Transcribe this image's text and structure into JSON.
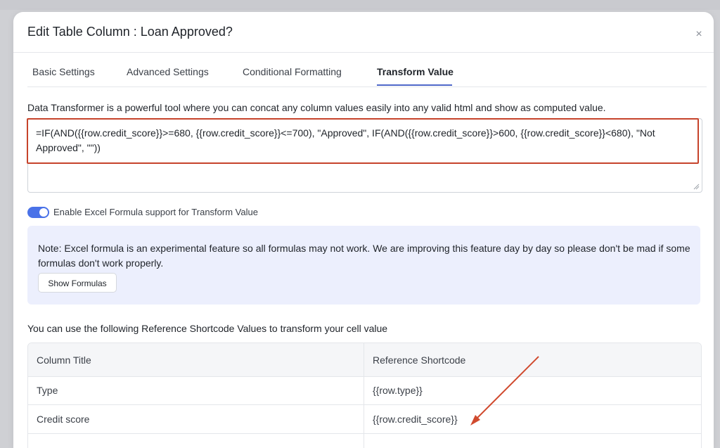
{
  "modal": {
    "title": "Edit Table Column : Loan Approved?",
    "close_symbol": "×"
  },
  "tabs": [
    {
      "label": "Basic Settings",
      "active": false
    },
    {
      "label": "Advanced Settings",
      "active": false
    },
    {
      "label": "Conditional Formatting",
      "active": false
    },
    {
      "label": "Transform Value",
      "active": true
    }
  ],
  "transform": {
    "description": "Data Transformer is a powerful tool where you can concat any column values easily into any valid html and show as computed value.",
    "formula": "=IF(AND({{row.credit_score}}>=680, {{row.credit_score}}<=700), \"Approved\", IF(AND({{row.credit_score}}>600, {{row.credit_score}}<680), \"Not Approved\", \"\"))"
  },
  "excel_toggle": {
    "label": "Enable Excel Formula support for Transform Value",
    "enabled": true
  },
  "note": {
    "text": "Note: Excel formula is an experimental feature so all formulas may not work. We are improving this feature day by day so please don't be mad if some formulas don't work properly.",
    "button_label": "Show Formulas"
  },
  "reference": {
    "heading": "You can use the following Reference Shortcode Values to transform your cell value",
    "columns": [
      "Column Title",
      "Reference Shortcode"
    ],
    "rows": [
      {
        "title": "Type",
        "shortcode": "{{row.type}}"
      },
      {
        "title": "Credit score",
        "shortcode": "{{row.credit_score}}"
      }
    ]
  },
  "colors": {
    "accent": "#4a72e8",
    "highlight_border": "#c6432b",
    "note_background": "#eceffd"
  }
}
